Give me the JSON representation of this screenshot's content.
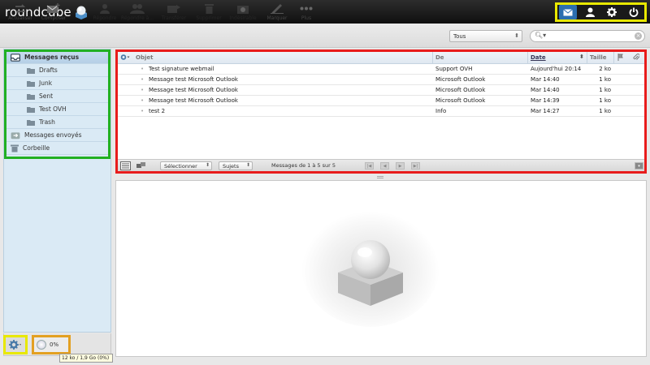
{
  "app": {
    "name": "roundcube"
  },
  "toolbar": {
    "buttons": [
      {
        "label": "Actualiser",
        "icon": "refresh-icon",
        "enabled": true
      },
      {
        "label": "Composer",
        "icon": "compose-icon",
        "enabled": true
      },
      {
        "label": "Répondre",
        "icon": "reply-icon",
        "enabled": false
      },
      {
        "label": "Répondre à...",
        "icon": "reply-all-icon",
        "enabled": false
      },
      {
        "label": "Transférer",
        "icon": "forward-icon",
        "enabled": false
      },
      {
        "label": "Supprimer",
        "icon": "delete-icon",
        "enabled": false
      },
      {
        "label": "Indésirable",
        "icon": "spam-icon",
        "enabled": false
      },
      {
        "label": "Marquer",
        "icon": "mark-icon",
        "enabled": true
      },
      {
        "label": "Plus",
        "icon": "more-icon",
        "enabled": true
      }
    ],
    "filter": "Tous",
    "search_value": ""
  },
  "folders": [
    {
      "label": "Messages reçus",
      "selected": true,
      "level": 0,
      "icon": "inbox-icon"
    },
    {
      "label": "Drafts",
      "selected": false,
      "level": 1,
      "icon": "folder-icon"
    },
    {
      "label": "Junk",
      "selected": false,
      "level": 1,
      "icon": "folder-icon"
    },
    {
      "label": "Sent",
      "selected": false,
      "level": 1,
      "icon": "folder-icon"
    },
    {
      "label": "Test OVH",
      "selected": false,
      "level": 1,
      "icon": "folder-icon"
    },
    {
      "label": "Trash",
      "selected": false,
      "level": 1,
      "icon": "folder-icon"
    },
    {
      "label": "Messages envoyés",
      "selected": false,
      "level": 0,
      "icon": "sent-icon"
    },
    {
      "label": "Corbeille",
      "selected": false,
      "level": 0,
      "icon": "trash-icon"
    }
  ],
  "list": {
    "columns": {
      "subject": "Objet",
      "from": "De",
      "date": "Date",
      "size": "Taille"
    },
    "rows": [
      {
        "subject": "Test signature webmail",
        "from": "Support OVH",
        "date": "Aujourd'hui 20:14",
        "size": "2 ko"
      },
      {
        "subject": "Message test Microsoft Outlook",
        "from": "Microsoft Outlook",
        "date": "Mar 14:40",
        "size": "1 ko"
      },
      {
        "subject": "Message test Microsoft Outlook",
        "from": "Microsoft Outlook",
        "date": "Mar 14:40",
        "size": "1 ko"
      },
      {
        "subject": "Message test Microsoft Outlook",
        "from": "Microsoft Outlook",
        "date": "Mar 14:39",
        "size": "1 ko"
      },
      {
        "subject": "test 2",
        "from": "Info",
        "date": "Mar 14:27",
        "size": "1 ko"
      }
    ],
    "footer": {
      "select_label": "Sélectionner",
      "threads_label": "Sujets",
      "count_text": "Messages de 1 à 5 sur 5"
    }
  },
  "quota": {
    "percent_label": "0%",
    "tooltip": "12 ko / 1,9 Go (0%)"
  }
}
